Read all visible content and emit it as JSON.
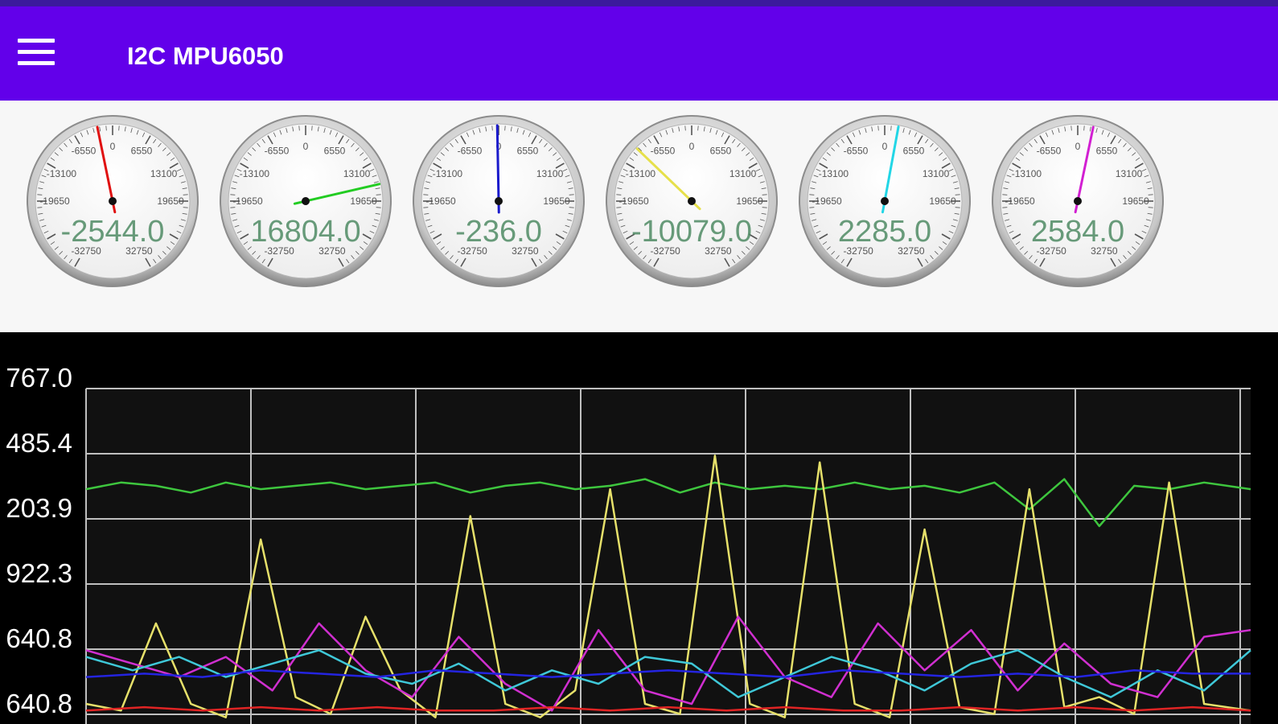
{
  "app": {
    "title": "I2C MPU6050",
    "menu_icon": "hamburger-menu-icon"
  },
  "colors": {
    "appbar": "#6200ea",
    "topstrip": "#3b1a9c"
  },
  "gauges": [
    {
      "id": "gauge-1",
      "value": -2544.0,
      "label": "-2544.0",
      "needle_color": "#e01010"
    },
    {
      "id": "gauge-2",
      "value": 16804.0,
      "label": "16804.0",
      "needle_color": "#22cc22"
    },
    {
      "id": "gauge-3",
      "value": -236.0,
      "label": "-236.0",
      "needle_color": "#1a1acc"
    },
    {
      "id": "gauge-4",
      "value": -10079.0,
      "label": "-10079.0",
      "needle_color": "#e6e04a"
    },
    {
      "id": "gauge-5",
      "value": 2285.0,
      "label": "2285.0",
      "needle_color": "#22d6e6"
    },
    {
      "id": "gauge-6",
      "value": 2584.0,
      "label": "2584.0",
      "needle_color": "#d21fd2"
    }
  ],
  "gauge_scale": {
    "min": -32750,
    "max": 32750,
    "labels": [
      "0",
      "6550",
      "13100",
      "19650",
      "-6550",
      "-13100",
      "-19650",
      "32750",
      "-32750"
    ]
  },
  "chart_data": {
    "type": "line",
    "y_tick_labels": [
      "767.0",
      "485.4",
      "203.9",
      "922.3",
      "640.8",
      "640.8"
    ],
    "grid": true,
    "series": [
      {
        "color": "#3ec63e",
        "x": [
          0,
          3,
          6,
          9,
          12,
          15,
          18,
          21,
          24,
          27,
          30,
          33,
          36,
          39,
          42,
          45,
          48,
          51,
          54,
          57,
          60,
          63,
          66,
          69,
          72,
          75,
          78,
          81,
          84,
          87,
          90,
          93,
          96,
          100
        ],
        "y": [
          0.7,
          0.72,
          0.71,
          0.69,
          0.72,
          0.7,
          0.71,
          0.72,
          0.7,
          0.71,
          0.72,
          0.69,
          0.71,
          0.72,
          0.7,
          0.71,
          0.73,
          0.69,
          0.72,
          0.7,
          0.71,
          0.7,
          0.72,
          0.7,
          0.71,
          0.69,
          0.72,
          0.64,
          0.73,
          0.59,
          0.71,
          0.7,
          0.72,
          0.7
        ]
      },
      {
        "color": "#e6e06a",
        "x": [
          0,
          3,
          6,
          9,
          12,
          15,
          18,
          21,
          24,
          27,
          30,
          33,
          36,
          39,
          42,
          45,
          48,
          51,
          54,
          57,
          60,
          63,
          66,
          69,
          72,
          75,
          78,
          81,
          84,
          87,
          90,
          93,
          96,
          100
        ],
        "y": [
          0.06,
          0.04,
          0.3,
          0.06,
          0.02,
          0.55,
          0.08,
          0.03,
          0.32,
          0.1,
          0.02,
          0.62,
          0.06,
          0.02,
          0.1,
          0.7,
          0.06,
          0.03,
          0.8,
          0.06,
          0.02,
          0.78,
          0.06,
          0.02,
          0.58,
          0.05,
          0.03,
          0.7,
          0.05,
          0.08,
          0.03,
          0.72,
          0.06,
          0.04
        ]
      },
      {
        "color": "#d02fd0",
        "x": [
          0,
          4,
          8,
          12,
          16,
          20,
          24,
          28,
          32,
          36,
          40,
          44,
          48,
          52,
          56,
          60,
          64,
          68,
          72,
          76,
          80,
          84,
          88,
          92,
          96,
          100
        ],
        "y": [
          0.22,
          0.18,
          0.14,
          0.2,
          0.1,
          0.3,
          0.16,
          0.08,
          0.26,
          0.12,
          0.04,
          0.28,
          0.1,
          0.06,
          0.32,
          0.14,
          0.08,
          0.3,
          0.16,
          0.28,
          0.1,
          0.24,
          0.12,
          0.08,
          0.26,
          0.28
        ]
      },
      {
        "color": "#3fc8d8",
        "x": [
          0,
          4,
          8,
          12,
          16,
          20,
          24,
          28,
          32,
          36,
          40,
          44,
          48,
          52,
          56,
          60,
          64,
          68,
          72,
          76,
          80,
          84,
          88,
          92,
          96,
          100
        ],
        "y": [
          0.2,
          0.16,
          0.2,
          0.14,
          0.18,
          0.22,
          0.15,
          0.12,
          0.18,
          0.1,
          0.16,
          0.12,
          0.2,
          0.18,
          0.08,
          0.14,
          0.2,
          0.16,
          0.1,
          0.18,
          0.22,
          0.14,
          0.08,
          0.16,
          0.1,
          0.22
        ]
      },
      {
        "color": "#2424e0",
        "x": [
          0,
          5,
          10,
          15,
          20,
          25,
          30,
          35,
          40,
          45,
          50,
          55,
          60,
          65,
          70,
          75,
          80,
          85,
          90,
          95,
          100
        ],
        "y": [
          0.14,
          0.15,
          0.14,
          0.16,
          0.15,
          0.14,
          0.16,
          0.15,
          0.14,
          0.15,
          0.16,
          0.15,
          0.14,
          0.16,
          0.15,
          0.14,
          0.15,
          0.14,
          0.16,
          0.15,
          0.15
        ]
      },
      {
        "color": "#e02424",
        "x": [
          0,
          5,
          10,
          15,
          20,
          25,
          30,
          35,
          40,
          45,
          50,
          55,
          60,
          65,
          70,
          75,
          80,
          85,
          90,
          95,
          100
        ],
        "y": [
          0.04,
          0.05,
          0.04,
          0.05,
          0.04,
          0.05,
          0.04,
          0.04,
          0.05,
          0.04,
          0.05,
          0.04,
          0.05,
          0.04,
          0.04,
          0.05,
          0.04,
          0.05,
          0.04,
          0.05,
          0.04
        ]
      }
    ]
  }
}
